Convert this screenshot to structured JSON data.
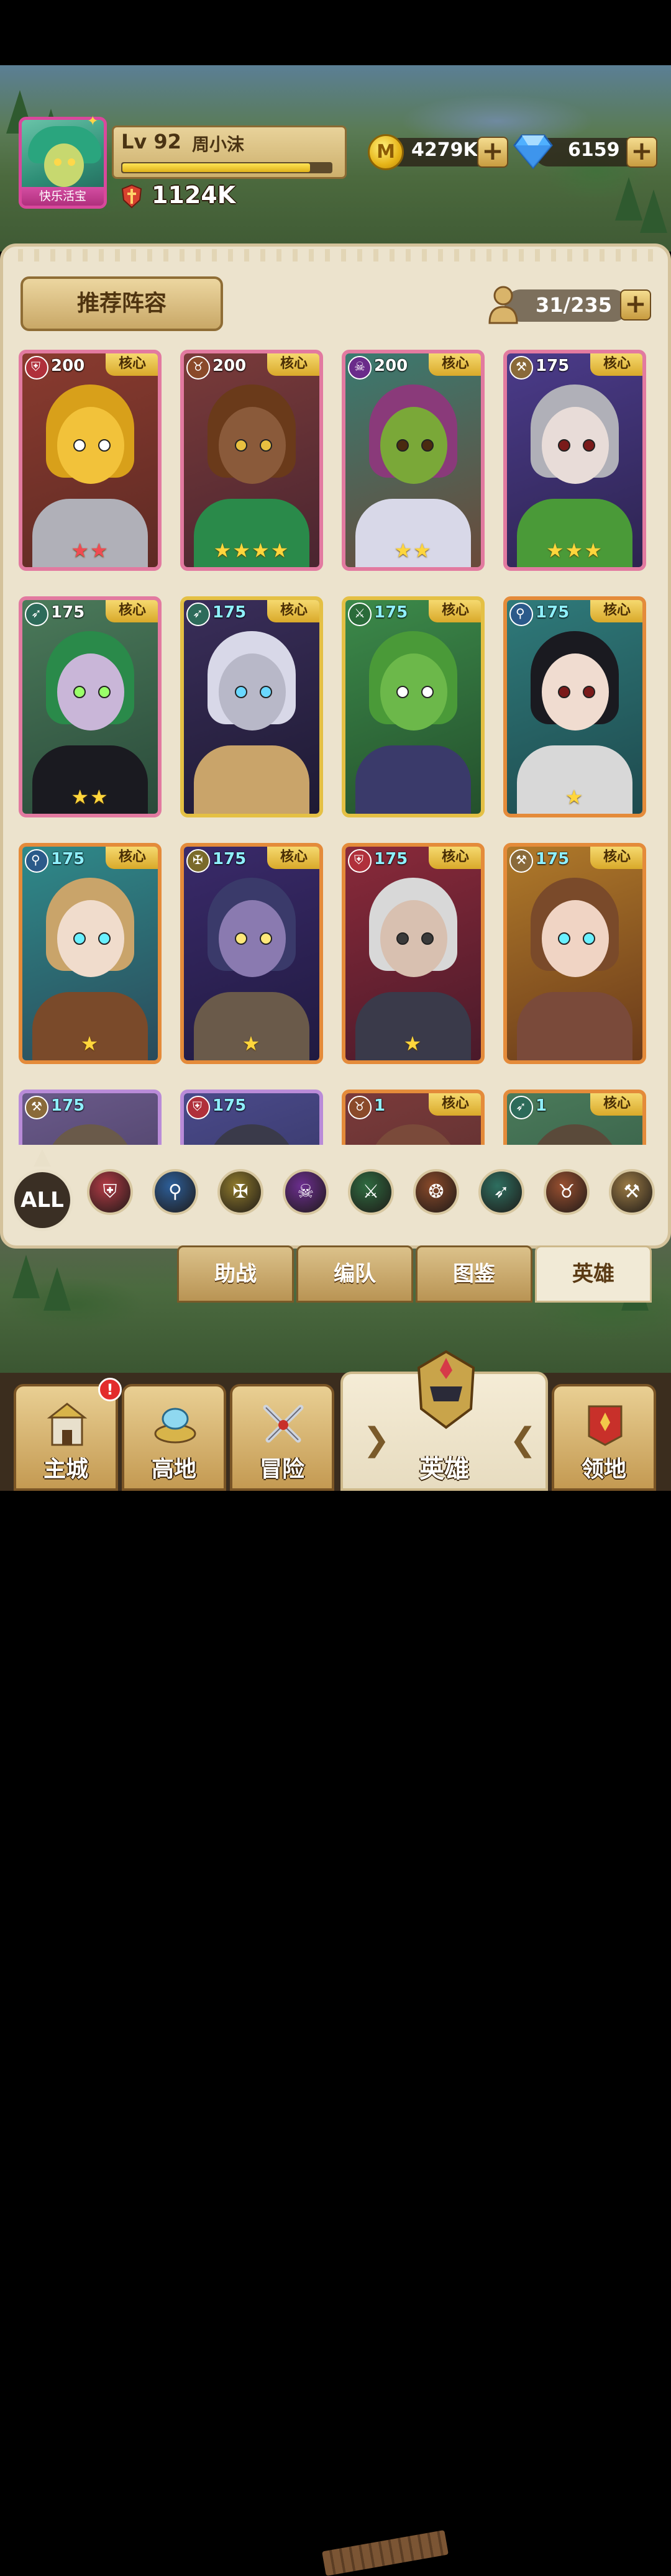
{
  "player": {
    "avatar_label": "快乐活宝",
    "level": "Lv 92",
    "name": "周小沫",
    "xp_fraction": 0.9,
    "power": "1124K"
  },
  "resources": {
    "gold": "4279K",
    "gems": "6159",
    "coin_glyph": "M"
  },
  "panel": {
    "recommend_label": "推荐阵容",
    "hero_count": "31/235"
  },
  "heroes": [
    {
      "level": "200",
      "core": "核心",
      "stars": 2,
      "star_color": "red",
      "frame": "pink",
      "class": "shield-icon",
      "badge_color": "#b0303b"
    },
    {
      "level": "200",
      "core": "核心",
      "stars": 4,
      "star_color": "gold",
      "frame": "pink",
      "class": "beast-icon",
      "badge_color": "#8a4a2a"
    },
    {
      "level": "200",
      "core": "核心",
      "stars": 2,
      "star_color": "gold",
      "frame": "pink",
      "class": "skull-icon",
      "badge_color": "#6a2b8a"
    },
    {
      "level": "175",
      "core": "核心",
      "stars": 3,
      "star_color": "gold",
      "frame": "pink",
      "class": "axe-icon",
      "badge_color": "#8a6a3a"
    },
    {
      "level": "175",
      "core": "核心",
      "stars": 2,
      "star_color": "gold",
      "frame": "pink",
      "class": "bow-icon",
      "badge_color": "#2d6b5a"
    },
    {
      "level": "175",
      "core": "核心",
      "stars": 0,
      "star_color": "gold",
      "frame": "gold",
      "class": "bow-icon",
      "badge_color": "#2d6b5a"
    },
    {
      "level": "175",
      "core": "核心",
      "stars": 0,
      "star_color": "gold",
      "frame": "gold",
      "class": "blades-icon",
      "badge_color": "#2a6b3a"
    },
    {
      "level": "175",
      "core": "核心",
      "stars": 1,
      "star_color": "gold",
      "frame": "orange",
      "class": "staff-icon",
      "badge_color": "#2b5a8a"
    },
    {
      "level": "175",
      "core": "核心",
      "stars": 1,
      "star_color": "gold",
      "frame": "orange",
      "class": "staff-icon",
      "badge_color": "#2b5a8a"
    },
    {
      "level": "175",
      "core": "核心",
      "stars": 1,
      "star_color": "gold",
      "frame": "orange",
      "class": "holy-icon",
      "badge_color": "#7a6a2a"
    },
    {
      "level": "175",
      "core": "核心",
      "stars": 1,
      "star_color": "gold",
      "frame": "orange",
      "class": "shield-icon",
      "badge_color": "#b0303b"
    },
    {
      "level": "175",
      "core": "核心",
      "stars": 0,
      "star_color": "gold",
      "frame": "orange",
      "class": "axe-icon",
      "badge_color": "#8a6a3a"
    },
    {
      "level": "175",
      "core": "",
      "stars": 0,
      "star_color": "gold",
      "frame": "purple",
      "class": "axe-icon",
      "badge_color": "#8a6a3a"
    },
    {
      "level": "175",
      "core": "",
      "stars": 0,
      "star_color": "gold",
      "frame": "purple",
      "class": "shield-icon",
      "badge_color": "#b0303b"
    },
    {
      "level": "1",
      "core": "核心",
      "stars": 0,
      "star_color": "gold",
      "frame": "orange",
      "class": "beast-icon",
      "badge_color": "#8a4a2a"
    },
    {
      "level": "1",
      "core": "核心",
      "stars": 0,
      "star_color": "gold",
      "frame": "orange",
      "class": "bow-icon",
      "badge_color": "#2d6b5a"
    }
  ],
  "filters": {
    "all_label": "ALL",
    "items": [
      {
        "name": "shield-filter",
        "glyph": "⛨",
        "color": "#b23a45"
      },
      {
        "name": "staff-filter",
        "glyph": "⚲",
        "color": "#2d5f9a"
      },
      {
        "name": "holy-filter",
        "glyph": "✠",
        "color": "#8f7a2c"
      },
      {
        "name": "skull-filter",
        "glyph": "☠",
        "color": "#6c2e90"
      },
      {
        "name": "blades-filter",
        "glyph": "⚔",
        "color": "#2f6b40"
      },
      {
        "name": "paw-filter",
        "glyph": "❂",
        "color": "#8a4a2a"
      },
      {
        "name": "bow-filter",
        "glyph": "➶",
        "color": "#2e6f60"
      },
      {
        "name": "beast-filter",
        "glyph": "♉",
        "color": "#9a5030"
      },
      {
        "name": "axe-filter",
        "glyph": "⚒",
        "color": "#9a7a44"
      }
    ]
  },
  "subtabs": [
    "助战",
    "编队",
    "图鉴",
    "英雄"
  ],
  "nav": {
    "main_city": "主城",
    "highland": "高地",
    "adventure": "冒险",
    "heroes": "英雄",
    "territory": "领地",
    "alert": "!"
  },
  "colors": {
    "panel_bg": "#ece3cd",
    "accent_gold": "#e4c044",
    "core_tag": "#f7dc73"
  }
}
